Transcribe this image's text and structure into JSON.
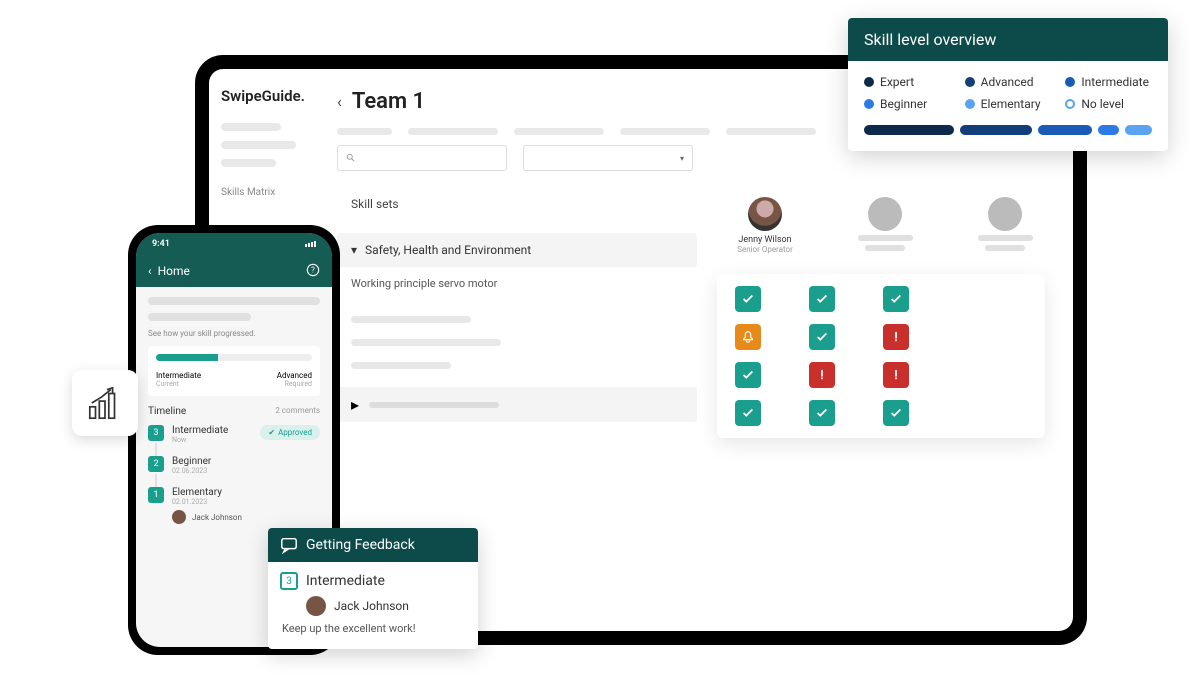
{
  "tablet": {
    "logo": "SwipeGuide.",
    "sidebar_label": "Skills Matrix",
    "back_icon": "‹",
    "title": "Team 1",
    "skillsets_label": "Skill sets",
    "group_caret": "▾",
    "skill_group": "Safety, Health and Environment",
    "skill_row": "Working principle servo motor",
    "collapsed_caret": "▸",
    "dropdown_caret": "▾",
    "people": [
      {
        "name": "Jenny Wilson",
        "role": "Senior Operator"
      }
    ]
  },
  "overview": {
    "title": "Skill level overview",
    "levels": [
      "Expert",
      "Advanced",
      "Intermediate",
      "Beginner",
      "Elementary",
      "No level"
    ]
  },
  "phone": {
    "time": "9:41",
    "home": "Home",
    "hint": "See how your skill progressed.",
    "current_level": "Intermediate",
    "current_label": "Current",
    "required_level": "Advanced",
    "required_label": "Required",
    "timeline_label": "Timeline",
    "comments_label": "2 comments",
    "items": [
      {
        "n": "3",
        "title": "Intermediate",
        "sub": "Now",
        "status": "Approved"
      },
      {
        "n": "2",
        "title": "Beginner",
        "sub": "02.06.2023"
      },
      {
        "n": "1",
        "title": "Elementary",
        "sub": "02.01.2023",
        "person": "Jack Johnson"
      }
    ]
  },
  "feedback": {
    "header": "Getting Feedback",
    "level_n": "3",
    "level": "Intermediate",
    "person": "Jack Johnson",
    "message": "Keep up the excellent work!"
  }
}
